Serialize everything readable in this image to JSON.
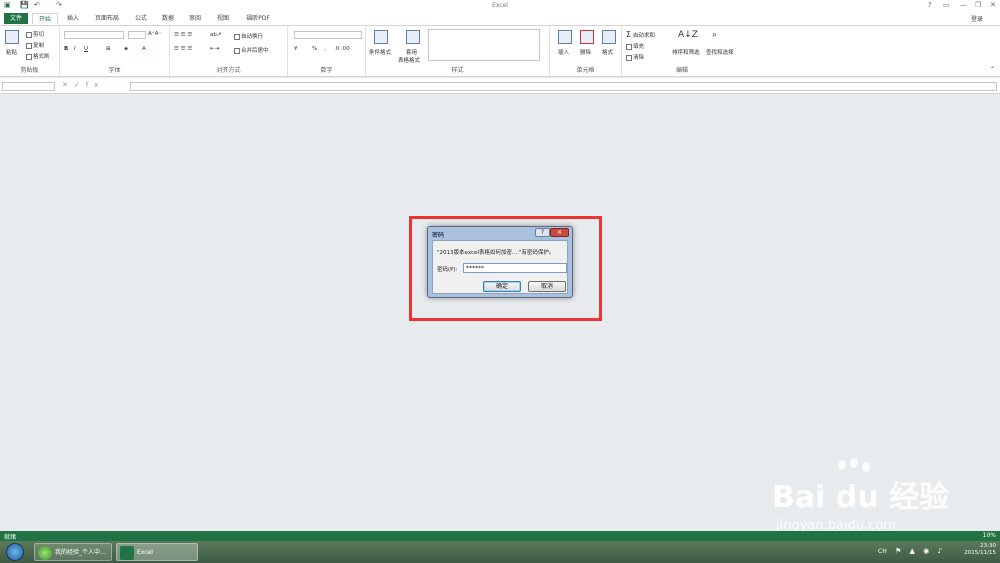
{
  "window": {
    "title": "Excel",
    "login": "登录"
  },
  "tabs": [
    "文件",
    "开始",
    "插入",
    "页面布局",
    "公式",
    "数据",
    "审阅",
    "视图",
    "福昕PDF"
  ],
  "ribbon": {
    "clipboard": {
      "label": "剪贴板",
      "paste": "粘贴",
      "cut": "剪切",
      "copy": "复制",
      "format_painter": "格式刷"
    },
    "font": {
      "label": "字体"
    },
    "alignment": {
      "label": "对齐方式",
      "wrap": "自动换行",
      "merge": "合并后居中"
    },
    "number": {
      "label": "数字",
      "percent": "%"
    },
    "styles": {
      "label": "样式",
      "conditional": "条件格式",
      "table_format_1": "套用",
      "table_format_2": "表格格式"
    },
    "cells": {
      "label": "单元格",
      "insert": "插入",
      "delete": "删除",
      "format": "格式"
    },
    "editing": {
      "label": "编辑",
      "autosum": "自动求和",
      "fill": "填充",
      "clear": "清除",
      "sort_filter": "排序和筛选",
      "find_select": "查找和选择"
    }
  },
  "formula_bar": {
    "fx": "fx"
  },
  "dialog": {
    "title": "密码",
    "help": "?",
    "close": "✕",
    "message": "\"2013版本excel表格如何加密....\"有密码保护。",
    "password_label": "密码(P):",
    "password_value": "******",
    "ok": "确定",
    "cancel": "取消"
  },
  "status": {
    "text": "就绪",
    "zoom": "10%"
  },
  "taskbar": {
    "items": [
      "我的经验_个人中...",
      "Excel"
    ],
    "lang": "CH",
    "time": "23:30",
    "date": "2015/11/15"
  },
  "watermark": {
    "logo": "Bai du 经验",
    "site": "jingyan.baidu.com"
  },
  "colors": {
    "excel_green": "#217346",
    "highlight": "#ee3333",
    "dialog_frame": "#a9c1df"
  }
}
